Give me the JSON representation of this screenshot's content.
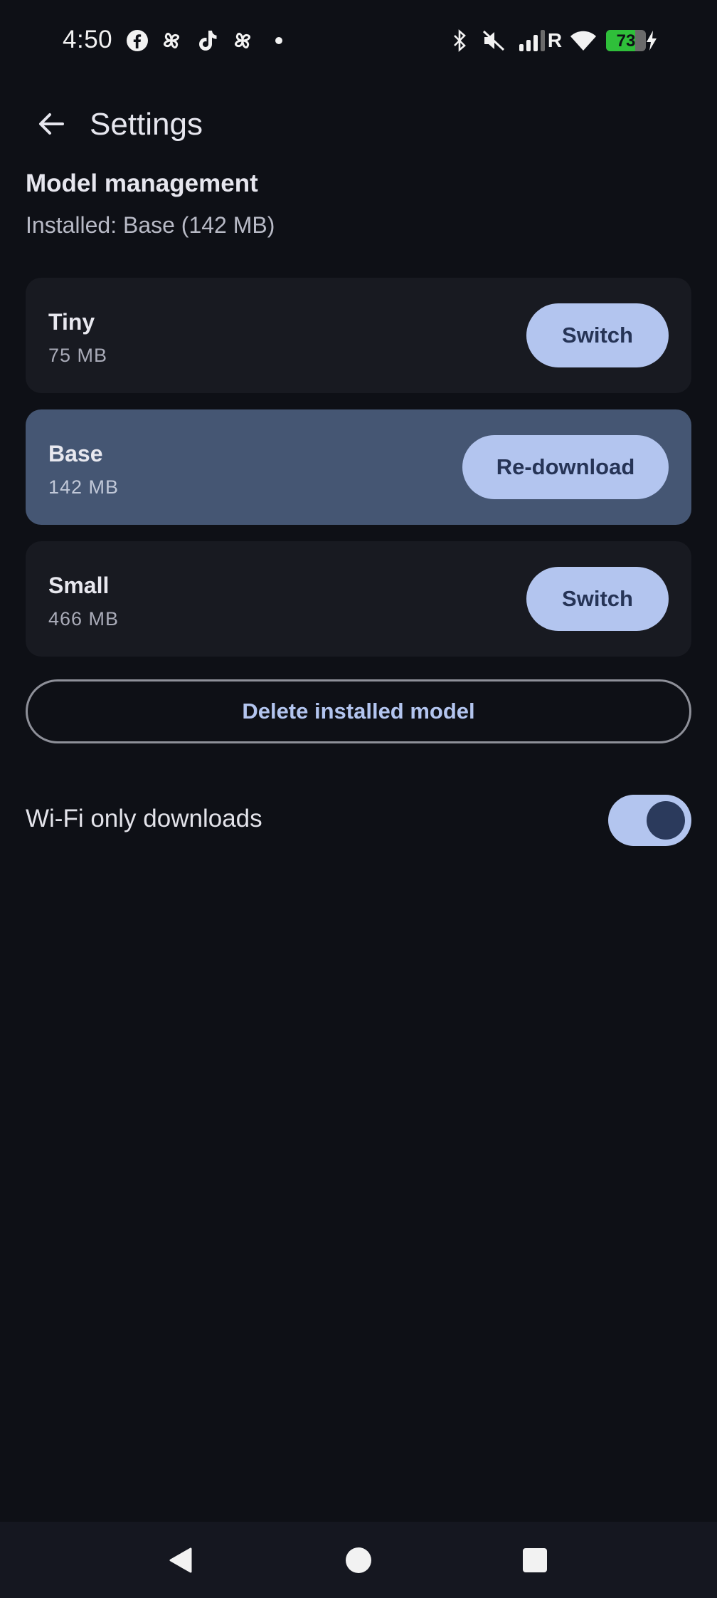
{
  "status_bar": {
    "time": "4:50",
    "battery_level": "73",
    "battery_percent": 73,
    "notification_icons": [
      "facebook-icon",
      "pinwheel-icon",
      "tiktok-icon",
      "pinwheel-icon",
      "dot-icon"
    ],
    "system_icons": [
      "bluetooth-icon",
      "mute-icon",
      "signal-icon",
      "roaming-icon",
      "wifi-icon",
      "battery-icon",
      "charging-icon"
    ],
    "roaming_label": "R"
  },
  "header": {
    "title": "Settings"
  },
  "model_management": {
    "title": "Model management",
    "installed": "Installed: Base (142 MB)",
    "models": [
      {
        "name": "Tiny",
        "size": "75 MB",
        "action": "Switch",
        "selected": false
      },
      {
        "name": "Base",
        "size": "142 MB",
        "action": "Re-download",
        "selected": true
      },
      {
        "name": "Small",
        "size": "466 MB",
        "action": "Switch",
        "selected": false
      }
    ],
    "delete_label": "Delete installed model"
  },
  "wifi_only": {
    "label": "Wi-Fi only downloads",
    "enabled": true
  },
  "colors": {
    "background": "#0e1016",
    "card": "#181a21",
    "card_selected": "#455673",
    "accent": "#b3c5ef",
    "accent_text": "#263456"
  }
}
